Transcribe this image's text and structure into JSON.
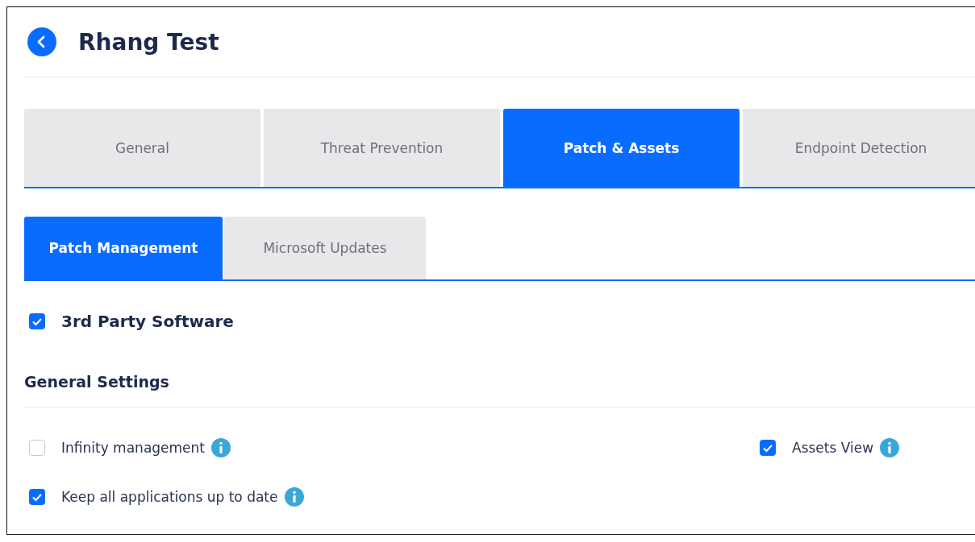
{
  "header": {
    "title": "Rhang Test"
  },
  "tabs": [
    {
      "label": "General",
      "selected": false
    },
    {
      "label": "Threat Prevention",
      "selected": false
    },
    {
      "label": "Patch & Assets",
      "selected": true
    },
    {
      "label": "Endpoint Detection",
      "selected": false
    }
  ],
  "subtabs": [
    {
      "label": "Patch Management",
      "selected": true
    },
    {
      "label": "Microsoft Updates",
      "selected": false
    }
  ],
  "section_toggle": {
    "label": "3rd Party Software",
    "checked": true
  },
  "settings": {
    "title": "General Settings",
    "options": [
      {
        "label": "Infinity management",
        "checked": false
      },
      {
        "label": "Assets View",
        "checked": true
      },
      {
        "label": "Keep all applications up to date",
        "checked": true
      }
    ]
  }
}
